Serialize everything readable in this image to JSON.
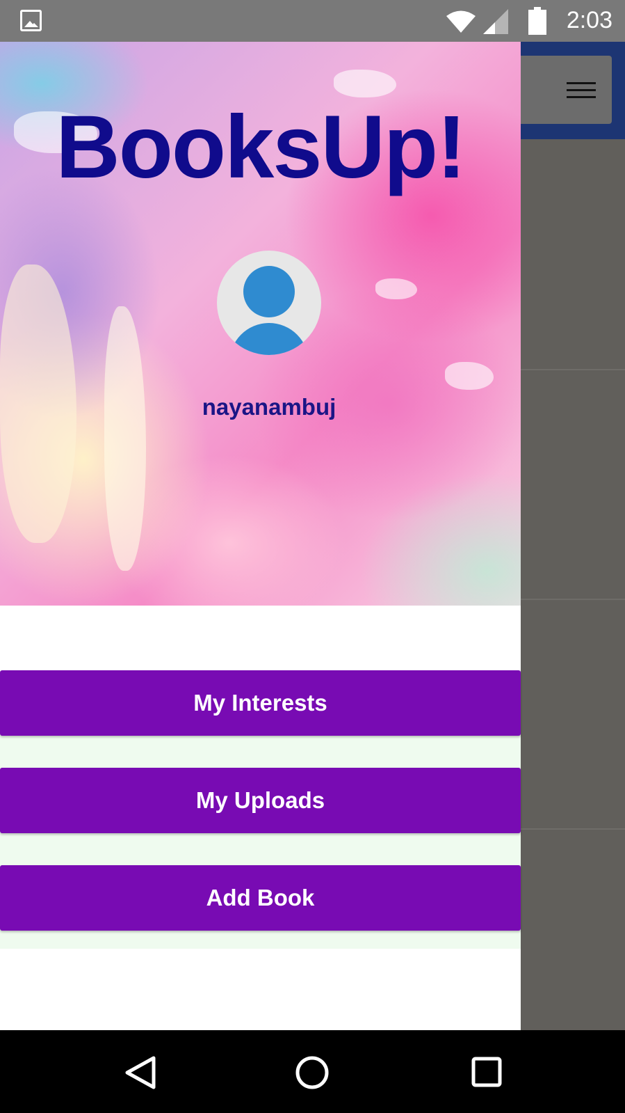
{
  "status_bar": {
    "time": "2:03",
    "icons": [
      "image-notification-icon",
      "wifi-icon",
      "cell-signal-icon",
      "battery-icon"
    ]
  },
  "drawer": {
    "app_title": "BooksUp!",
    "username": "nayanambuj",
    "buttons": [
      {
        "label": "My Interests"
      },
      {
        "label": "My Uploads"
      },
      {
        "label": "Add Book"
      }
    ]
  },
  "background_app": {
    "menu_icon": "hamburger-menu-icon"
  },
  "navigation_bar": {
    "icons": [
      "back-icon",
      "home-icon",
      "recents-icon"
    ]
  },
  "colors": {
    "status_bar": "#797979",
    "button_purple": "#780bb3",
    "title_blue": "#100b8c",
    "avatar_blue": "#2f8bd0",
    "toolbar_blue": "#1d3573",
    "button_area_bg": "#effbef"
  }
}
